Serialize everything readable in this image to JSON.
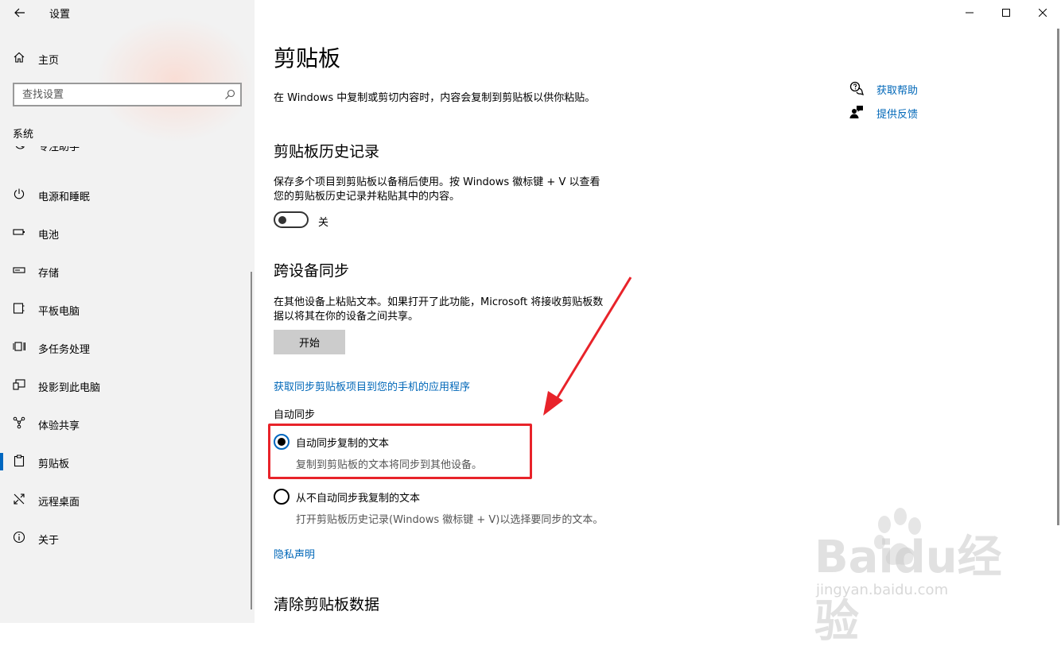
{
  "window": {
    "title": "设置"
  },
  "sidebar": {
    "home_label": "主页",
    "search_placeholder": "查找设置",
    "section_title": "系统",
    "partial_item_label": "专注助手",
    "items": [
      {
        "label": "电源和睡眠",
        "icon": "power-icon"
      },
      {
        "label": "电池",
        "icon": "battery-icon"
      },
      {
        "label": "存储",
        "icon": "storage-icon"
      },
      {
        "label": "平板电脑",
        "icon": "tablet-icon"
      },
      {
        "label": "多任务处理",
        "icon": "multitask-icon"
      },
      {
        "label": "投影到此电脑",
        "icon": "project-icon"
      },
      {
        "label": "体验共享",
        "icon": "shared-experience-icon"
      },
      {
        "label": "剪贴板",
        "icon": "clipboard-icon",
        "active": true
      },
      {
        "label": "远程桌面",
        "icon": "remote-desktop-icon"
      },
      {
        "label": "关于",
        "icon": "info-icon"
      }
    ]
  },
  "main": {
    "title": "剪贴板",
    "description": "在 Windows 中复制或剪切内容时，内容会复制到剪贴板以供你粘贴。",
    "help": {
      "get_help": "获取帮助",
      "feedback": "提供反馈"
    },
    "history": {
      "heading": "剪贴板历史记录",
      "desc_line1": "保存多个项目到剪贴板以备稍后使用。按 Windows 徽标键 + V 以查看",
      "desc_line2": "您的剪贴板历史记录并粘贴其中的内容。",
      "toggle_state": "关",
      "toggle_on": false
    },
    "sync": {
      "heading": "跨设备同步",
      "desc_line1": "在其他设备上粘贴文本。如果打开了此功能，Microsoft 将接收剪贴板数",
      "desc_line2": "据以将其在你的设备之间共享。",
      "start_button": "开始",
      "phone_link": "获取同步剪贴板项目到您的手机的应用程序",
      "auto_sync_label": "自动同步",
      "option_auto": "自动同步复制的文本",
      "option_auto_desc": "复制到剪贴板的文本将同步到其他设备。",
      "option_manual": "从不自动同步我复制的文本",
      "option_manual_desc": "打开剪贴板历史记录(Windows 徽标键 + V)以选择要同步的文本。",
      "selected_option": "auto"
    },
    "privacy_link": "隐私声明",
    "clear_heading": "清除剪贴板数据"
  },
  "watermark": {
    "main": "Baidu经验",
    "sub": "jingyan.baidu.com"
  },
  "colors": {
    "accent": "#0067c0",
    "link": "#0067b8",
    "annotation": "#e8232a"
  }
}
